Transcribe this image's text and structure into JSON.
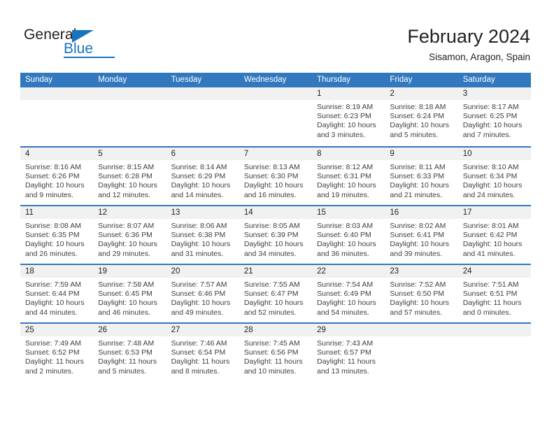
{
  "brand": {
    "name_part1": "General",
    "name_part2": "Blue"
  },
  "header": {
    "month_title": "February 2024",
    "location": "Sisamon, Aragon, Spain"
  },
  "colors": {
    "header_blue": "#3278be",
    "brand_blue": "#1a74bb",
    "daynum_band": "#f1f1f1",
    "text": "#231f20"
  },
  "calendar": {
    "weekdays": [
      "Sunday",
      "Monday",
      "Tuesday",
      "Wednesday",
      "Thursday",
      "Friday",
      "Saturday"
    ],
    "weeks": [
      [
        {
          "day": "",
          "sunrise": "",
          "sunset": "",
          "daylight_line1": "",
          "daylight_line2": ""
        },
        {
          "day": "",
          "sunrise": "",
          "sunset": "",
          "daylight_line1": "",
          "daylight_line2": ""
        },
        {
          "day": "",
          "sunrise": "",
          "sunset": "",
          "daylight_line1": "",
          "daylight_line2": ""
        },
        {
          "day": "",
          "sunrise": "",
          "sunset": "",
          "daylight_line1": "",
          "daylight_line2": ""
        },
        {
          "day": "1",
          "sunrise": "Sunrise: 8:19 AM",
          "sunset": "Sunset: 6:23 PM",
          "daylight_line1": "Daylight: 10 hours",
          "daylight_line2": "and 3 minutes."
        },
        {
          "day": "2",
          "sunrise": "Sunrise: 8:18 AM",
          "sunset": "Sunset: 6:24 PM",
          "daylight_line1": "Daylight: 10 hours",
          "daylight_line2": "and 5 minutes."
        },
        {
          "day": "3",
          "sunrise": "Sunrise: 8:17 AM",
          "sunset": "Sunset: 6:25 PM",
          "daylight_line1": "Daylight: 10 hours",
          "daylight_line2": "and 7 minutes."
        }
      ],
      [
        {
          "day": "4",
          "sunrise": "Sunrise: 8:16 AM",
          "sunset": "Sunset: 6:26 PM",
          "daylight_line1": "Daylight: 10 hours",
          "daylight_line2": "and 9 minutes."
        },
        {
          "day": "5",
          "sunrise": "Sunrise: 8:15 AM",
          "sunset": "Sunset: 6:28 PM",
          "daylight_line1": "Daylight: 10 hours",
          "daylight_line2": "and 12 minutes."
        },
        {
          "day": "6",
          "sunrise": "Sunrise: 8:14 AM",
          "sunset": "Sunset: 6:29 PM",
          "daylight_line1": "Daylight: 10 hours",
          "daylight_line2": "and 14 minutes."
        },
        {
          "day": "7",
          "sunrise": "Sunrise: 8:13 AM",
          "sunset": "Sunset: 6:30 PM",
          "daylight_line1": "Daylight: 10 hours",
          "daylight_line2": "and 16 minutes."
        },
        {
          "day": "8",
          "sunrise": "Sunrise: 8:12 AM",
          "sunset": "Sunset: 6:31 PM",
          "daylight_line1": "Daylight: 10 hours",
          "daylight_line2": "and 19 minutes."
        },
        {
          "day": "9",
          "sunrise": "Sunrise: 8:11 AM",
          "sunset": "Sunset: 6:33 PM",
          "daylight_line1": "Daylight: 10 hours",
          "daylight_line2": "and 21 minutes."
        },
        {
          "day": "10",
          "sunrise": "Sunrise: 8:10 AM",
          "sunset": "Sunset: 6:34 PM",
          "daylight_line1": "Daylight: 10 hours",
          "daylight_line2": "and 24 minutes."
        }
      ],
      [
        {
          "day": "11",
          "sunrise": "Sunrise: 8:08 AM",
          "sunset": "Sunset: 6:35 PM",
          "daylight_line1": "Daylight: 10 hours",
          "daylight_line2": "and 26 minutes."
        },
        {
          "day": "12",
          "sunrise": "Sunrise: 8:07 AM",
          "sunset": "Sunset: 6:36 PM",
          "daylight_line1": "Daylight: 10 hours",
          "daylight_line2": "and 29 minutes."
        },
        {
          "day": "13",
          "sunrise": "Sunrise: 8:06 AM",
          "sunset": "Sunset: 6:38 PM",
          "daylight_line1": "Daylight: 10 hours",
          "daylight_line2": "and 31 minutes."
        },
        {
          "day": "14",
          "sunrise": "Sunrise: 8:05 AM",
          "sunset": "Sunset: 6:39 PM",
          "daylight_line1": "Daylight: 10 hours",
          "daylight_line2": "and 34 minutes."
        },
        {
          "day": "15",
          "sunrise": "Sunrise: 8:03 AM",
          "sunset": "Sunset: 6:40 PM",
          "daylight_line1": "Daylight: 10 hours",
          "daylight_line2": "and 36 minutes."
        },
        {
          "day": "16",
          "sunrise": "Sunrise: 8:02 AM",
          "sunset": "Sunset: 6:41 PM",
          "daylight_line1": "Daylight: 10 hours",
          "daylight_line2": "and 39 minutes."
        },
        {
          "day": "17",
          "sunrise": "Sunrise: 8:01 AM",
          "sunset": "Sunset: 6:42 PM",
          "daylight_line1": "Daylight: 10 hours",
          "daylight_line2": "and 41 minutes."
        }
      ],
      [
        {
          "day": "18",
          "sunrise": "Sunrise: 7:59 AM",
          "sunset": "Sunset: 6:44 PM",
          "daylight_line1": "Daylight: 10 hours",
          "daylight_line2": "and 44 minutes."
        },
        {
          "day": "19",
          "sunrise": "Sunrise: 7:58 AM",
          "sunset": "Sunset: 6:45 PM",
          "daylight_line1": "Daylight: 10 hours",
          "daylight_line2": "and 46 minutes."
        },
        {
          "day": "20",
          "sunrise": "Sunrise: 7:57 AM",
          "sunset": "Sunset: 6:46 PM",
          "daylight_line1": "Daylight: 10 hours",
          "daylight_line2": "and 49 minutes."
        },
        {
          "day": "21",
          "sunrise": "Sunrise: 7:55 AM",
          "sunset": "Sunset: 6:47 PM",
          "daylight_line1": "Daylight: 10 hours",
          "daylight_line2": "and 52 minutes."
        },
        {
          "day": "22",
          "sunrise": "Sunrise: 7:54 AM",
          "sunset": "Sunset: 6:49 PM",
          "daylight_line1": "Daylight: 10 hours",
          "daylight_line2": "and 54 minutes."
        },
        {
          "day": "23",
          "sunrise": "Sunrise: 7:52 AM",
          "sunset": "Sunset: 6:50 PM",
          "daylight_line1": "Daylight: 10 hours",
          "daylight_line2": "and 57 minutes."
        },
        {
          "day": "24",
          "sunrise": "Sunrise: 7:51 AM",
          "sunset": "Sunset: 6:51 PM",
          "daylight_line1": "Daylight: 11 hours",
          "daylight_line2": "and 0 minutes."
        }
      ],
      [
        {
          "day": "25",
          "sunrise": "Sunrise: 7:49 AM",
          "sunset": "Sunset: 6:52 PM",
          "daylight_line1": "Daylight: 11 hours",
          "daylight_line2": "and 2 minutes."
        },
        {
          "day": "26",
          "sunrise": "Sunrise: 7:48 AM",
          "sunset": "Sunset: 6:53 PM",
          "daylight_line1": "Daylight: 11 hours",
          "daylight_line2": "and 5 minutes."
        },
        {
          "day": "27",
          "sunrise": "Sunrise: 7:46 AM",
          "sunset": "Sunset: 6:54 PM",
          "daylight_line1": "Daylight: 11 hours",
          "daylight_line2": "and 8 minutes."
        },
        {
          "day": "28",
          "sunrise": "Sunrise: 7:45 AM",
          "sunset": "Sunset: 6:56 PM",
          "daylight_line1": "Daylight: 11 hours",
          "daylight_line2": "and 10 minutes."
        },
        {
          "day": "29",
          "sunrise": "Sunrise: 7:43 AM",
          "sunset": "Sunset: 6:57 PM",
          "daylight_line1": "Daylight: 11 hours",
          "daylight_line2": "and 13 minutes."
        },
        {
          "day": "",
          "sunrise": "",
          "sunset": "",
          "daylight_line1": "",
          "daylight_line2": ""
        },
        {
          "day": "",
          "sunrise": "",
          "sunset": "",
          "daylight_line1": "",
          "daylight_line2": ""
        }
      ]
    ]
  }
}
